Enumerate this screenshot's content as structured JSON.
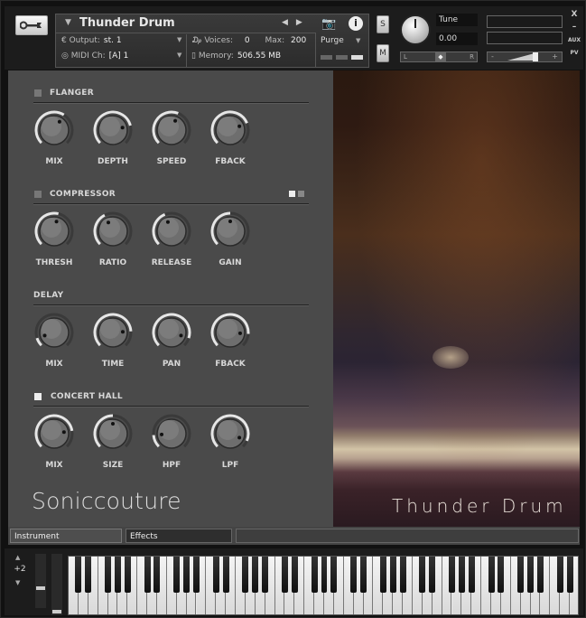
{
  "header": {
    "instrument_name": "Thunder Drum",
    "output_label": "Output:",
    "output_value": "st. 1",
    "midi_label": "MIDI Ch:",
    "midi_value": "[A]  1",
    "voices_label": "Voices:",
    "voices_value": "0",
    "max_label": "Max:",
    "max_value": "200",
    "memory_label": "Memory:",
    "memory_value": "506.55 MB",
    "purge_label": "Purge",
    "solo_label": "S",
    "mute_label": "M",
    "tune_label": "Tune",
    "tune_value": "0.00",
    "pan_left": "L",
    "pan_right": "R",
    "vol_minus": "-",
    "vol_plus": "+",
    "close_label": "X",
    "minimize_label": "–",
    "aux_label": "AUX",
    "pv_label": "PV",
    "info_label": "i"
  },
  "sections": {
    "flanger": {
      "title": "FLANGER",
      "knobs": [
        {
          "label": "MIX",
          "value": 0.62
        },
        {
          "label": "DEPTH",
          "value": 0.78
        },
        {
          "label": "SPEED",
          "value": 0.58
        },
        {
          "label": "FBACK",
          "value": 0.75
        }
      ]
    },
    "compressor": {
      "title": "COMPRESSOR",
      "knobs": [
        {
          "label": "THRESH",
          "value": 0.55
        },
        {
          "label": "RATIO",
          "value": 0.4
        },
        {
          "label": "RELEASE",
          "value": 0.42
        },
        {
          "label": "GAIN",
          "value": 0.5
        }
      ]
    },
    "delay": {
      "title": "DELAY",
      "knobs": [
        {
          "label": "MIX",
          "value": 0.1
        },
        {
          "label": "TIME",
          "value": 0.82
        },
        {
          "label": "PAN",
          "value": 0.9
        },
        {
          "label": "FBACK",
          "value": 0.85
        }
      ]
    },
    "concert_hall": {
      "title": "CONCERT HALL",
      "knobs": [
        {
          "label": "MIX",
          "value": 0.8
        },
        {
          "label": "SIZE",
          "value": 0.5
        },
        {
          "label": "HPF",
          "value": 0.15
        },
        {
          "label": "LPF",
          "value": 0.92
        }
      ]
    }
  },
  "brand": "Soniccouture",
  "artwork_title": "Thunder Drum",
  "tabs": {
    "instrument": "Instrument",
    "effects": "Effects"
  },
  "keyboard": {
    "octave_value": "+2",
    "white_keys": 52
  }
}
